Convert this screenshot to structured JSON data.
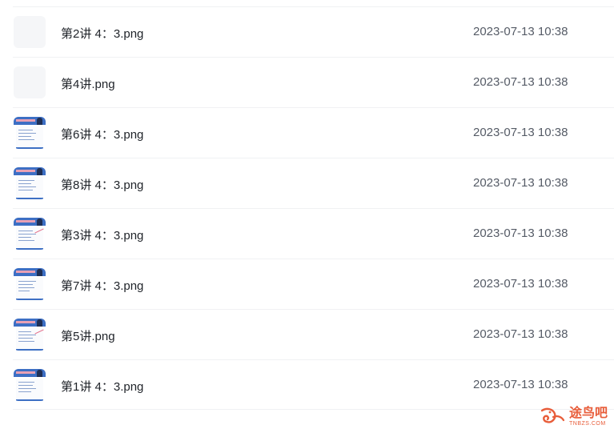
{
  "files": [
    {
      "name": "第2讲 4：3.png",
      "date": "2023-07-13 10:38",
      "thumb": "blank"
    },
    {
      "name": "第4讲.png",
      "date": "2023-07-13 10:38",
      "thumb": "blank"
    },
    {
      "name": "第6讲 4：3.png",
      "date": "2023-07-13 10:38",
      "thumb": "document"
    },
    {
      "name": "第8讲 4：3.png",
      "date": "2023-07-13 10:38",
      "thumb": "document"
    },
    {
      "name": "第3讲 4：3.png",
      "date": "2023-07-13 10:38",
      "thumb": "document"
    },
    {
      "name": "第7讲 4：3.png",
      "date": "2023-07-13 10:38",
      "thumb": "document"
    },
    {
      "name": "第5讲.png",
      "date": "2023-07-13 10:38",
      "thumb": "document"
    },
    {
      "name": "第1讲 4：3.png",
      "date": "2023-07-13 10:38",
      "thumb": "document"
    }
  ],
  "watermark": {
    "main": "途鸟吧",
    "sub": "TNBZS.COM"
  },
  "colors": {
    "accent": "#3d6fc4",
    "watermark": "#e85d3a"
  }
}
